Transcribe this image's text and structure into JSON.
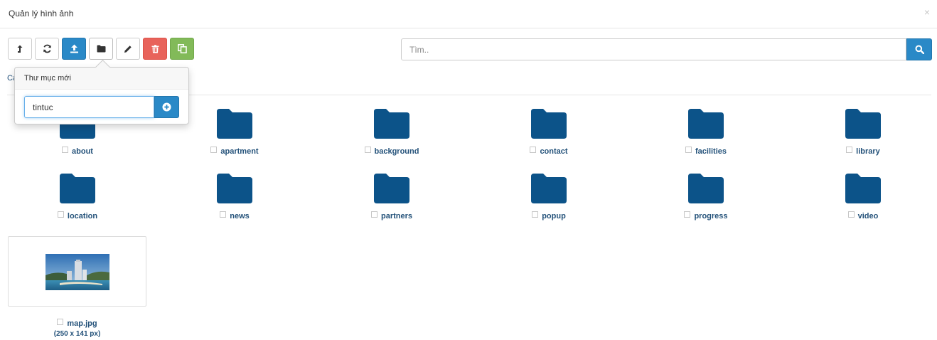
{
  "dialog": {
    "title": "Quản lý hình ảnh",
    "close_label": "×"
  },
  "toolbar": {
    "buttons": [
      {
        "name": "up-folder",
        "icon": "level-up-icon"
      },
      {
        "name": "refresh",
        "icon": "refresh-icon"
      },
      {
        "name": "upload",
        "icon": "upload-icon",
        "color": "#2a89c7"
      },
      {
        "name": "new-folder",
        "icon": "folder-icon"
      },
      {
        "name": "rename",
        "icon": "pencil-icon"
      },
      {
        "name": "delete",
        "icon": "trash-icon",
        "color": "#e8635b"
      },
      {
        "name": "copy",
        "icon": "copy-icon",
        "color": "#82ba59"
      }
    ]
  },
  "search": {
    "placeholder": "Tìm..",
    "value": "",
    "icon": "search-icon"
  },
  "breadcrumb": {
    "visible_text": "Cá"
  },
  "new_folder_popover": {
    "title": "Thư mục mới",
    "input_value": "tintuc",
    "add_icon": "plus-circle-icon"
  },
  "folders": [
    {
      "name": "about"
    },
    {
      "name": "apartment"
    },
    {
      "name": "background"
    },
    {
      "name": "contact"
    },
    {
      "name": "facilities"
    },
    {
      "name": "library"
    },
    {
      "name": "location"
    },
    {
      "name": "news"
    },
    {
      "name": "partners"
    },
    {
      "name": "popup"
    },
    {
      "name": "progress"
    },
    {
      "name": "video"
    }
  ],
  "images": [
    {
      "filename": "map.jpg",
      "dimensions": "(250 x 141 px)"
    }
  ],
  "colors": {
    "folder": "#0c5389",
    "link": "#24527a",
    "primary": "#2a89c7",
    "danger": "#e8635b",
    "success": "#82ba59"
  }
}
